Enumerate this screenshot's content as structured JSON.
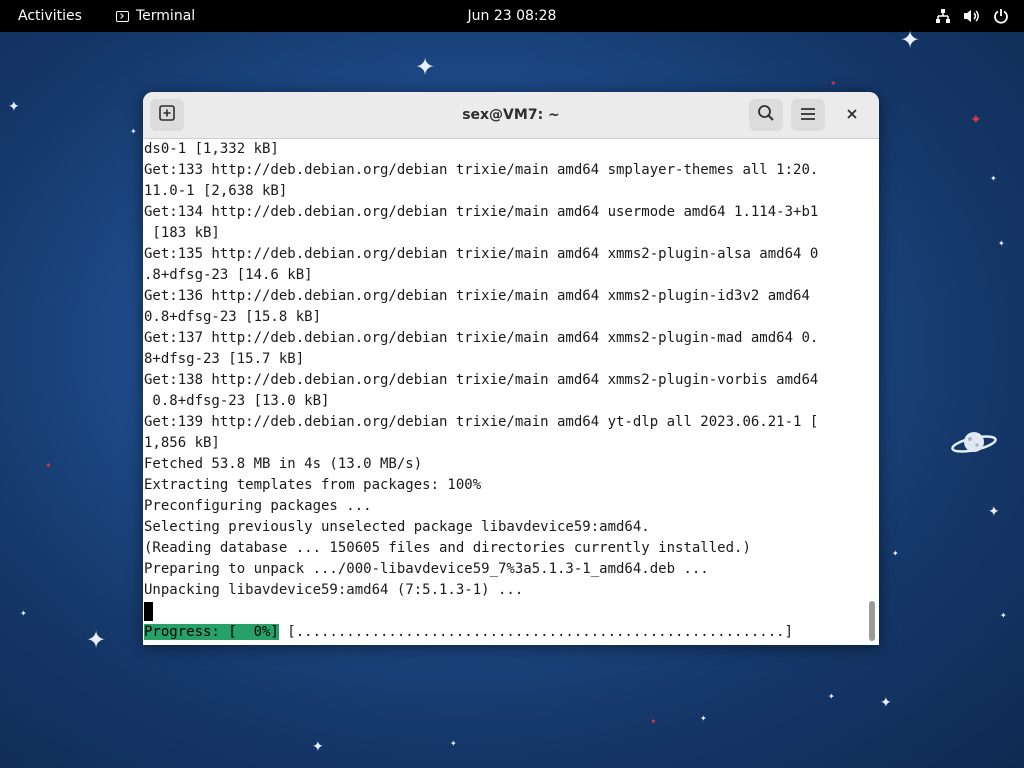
{
  "topbar": {
    "activities": "Activities",
    "app_name": "Terminal",
    "clock": "Jun 23  08:28"
  },
  "window": {
    "title": "sex@VM7: ~",
    "icons": {
      "new_tab": "new-tab-icon",
      "search": "search-icon",
      "menu": "hamburger-menu-icon",
      "close": "close-icon"
    }
  },
  "terminal": {
    "lines": [
      "ds0-1 [1,332 kB]",
      "Get:133 http://deb.debian.org/debian trixie/main amd64 smplayer-themes all 1:20.",
      "11.0-1 [2,638 kB]",
      "Get:134 http://deb.debian.org/debian trixie/main amd64 usermode amd64 1.114-3+b1",
      " [183 kB]",
      "Get:135 http://deb.debian.org/debian trixie/main amd64 xmms2-plugin-alsa amd64 0",
      ".8+dfsg-23 [14.6 kB]",
      "Get:136 http://deb.debian.org/debian trixie/main amd64 xmms2-plugin-id3v2 amd64",
      "0.8+dfsg-23 [15.8 kB]",
      "Get:137 http://deb.debian.org/debian trixie/main amd64 xmms2-plugin-mad amd64 0.",
      "8+dfsg-23 [15.7 kB]",
      "Get:138 http://deb.debian.org/debian trixie/main amd64 xmms2-plugin-vorbis amd64",
      " 0.8+dfsg-23 [13.0 kB]",
      "Get:139 http://deb.debian.org/debian trixie/main amd64 yt-dlp all 2023.06.21-1 [",
      "1,856 kB]",
      "Fetched 53.8 MB in 4s (13.0 MB/s)",
      "Extracting templates from packages: 100%",
      "Preconfiguring packages ...",
      "Selecting previously unselected package libavdevice59:amd64.",
      "(Reading database ... 150605 files and directories currently installed.)",
      "Preparing to unpack .../000-libavdevice59_7%3a5.1.3-1_amd64.deb ...",
      "Unpacking libavdevice59:amd64 (7:5.1.3-1) ..."
    ],
    "progress_label": "Progress: [  0%]",
    "progress_bar": " [..........................................................]",
    "progress_color": "#26a269"
  }
}
